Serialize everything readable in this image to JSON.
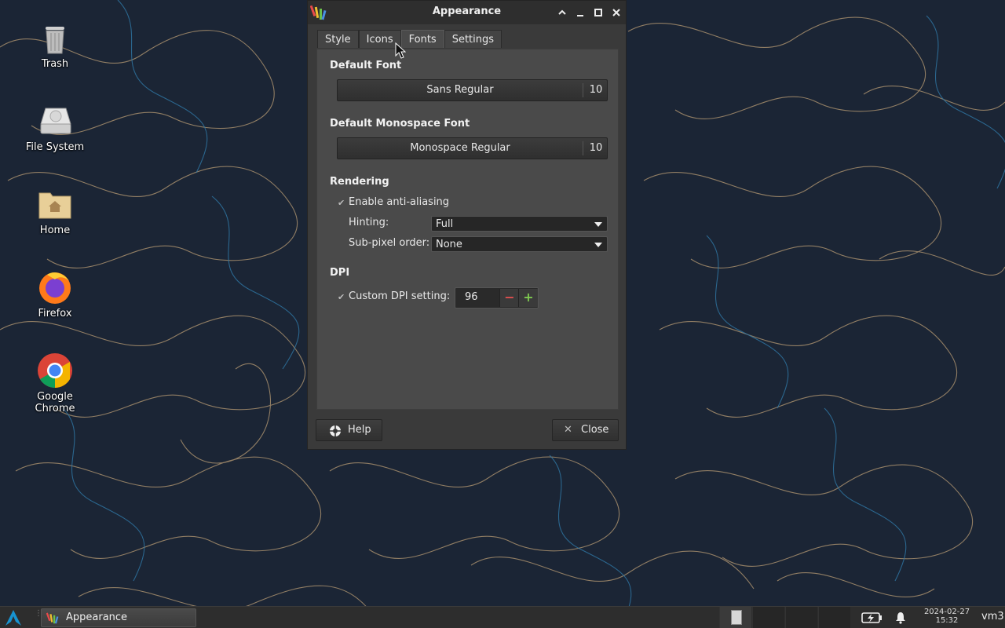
{
  "desktop": {
    "icons": [
      {
        "label": "Trash"
      },
      {
        "label": "File System"
      },
      {
        "label": "Home"
      },
      {
        "label": "Firefox"
      },
      {
        "label": "Google Chrome"
      }
    ]
  },
  "window": {
    "title": "Appearance",
    "tabs": [
      {
        "label": "Style",
        "active": false
      },
      {
        "label": "Icons",
        "active": false
      },
      {
        "label": "Fonts",
        "active": true
      },
      {
        "label": "Settings",
        "active": false
      }
    ],
    "fonts": {
      "default_font_heading": "Default Font",
      "default_font_name": "Sans Regular",
      "default_font_size": "10",
      "mono_font_heading": "Default Monospace Font",
      "mono_font_name": "Monospace Regular",
      "mono_font_size": "10"
    },
    "rendering": {
      "heading": "Rendering",
      "antialias_label": "Enable anti-aliasing",
      "antialias_checked": true,
      "hinting_label": "Hinting:",
      "hinting_value": "Full",
      "subpixel_label": "Sub-pixel order:",
      "subpixel_value": "None"
    },
    "dpi": {
      "heading": "DPI",
      "custom_label": "Custom DPI setting:",
      "custom_checked": true,
      "value": "96",
      "minus": "−",
      "plus": "+"
    },
    "buttons": {
      "help": "Help",
      "close": "Close"
    }
  },
  "taskbar": {
    "task_label": "Appearance",
    "date": "2024-02-27",
    "time": "15:32",
    "user": "vm3"
  },
  "colors": {
    "wallpaper_bg": "#1b2535",
    "line_warm": "#c9a77a",
    "line_cool": "#3a7fa8",
    "minus": "#e05050",
    "plus": "#7ec850"
  }
}
